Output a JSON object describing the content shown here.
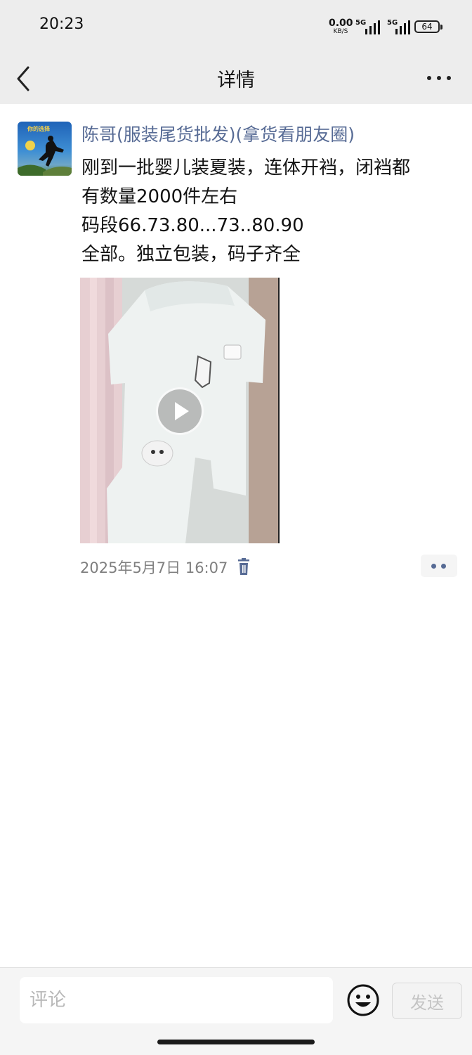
{
  "status_bar": {
    "time": "20:23",
    "net_speed_value": "0.00",
    "net_speed_unit": "KB/S",
    "signal_1_label": "5G",
    "signal_2_label": "5G",
    "battery": "64"
  },
  "header": {
    "title": "详情",
    "back_icon": "chevron-left-icon",
    "more_icon": "more-dots-icon"
  },
  "post": {
    "author": "陈哥(服装尾货批发)(拿货看朋友圈)",
    "avatar_text": "你的选择",
    "text_lines": [
      "刚到一批婴儿装夏装，连体开裆，闭裆都",
      "有数量2000件左右",
      "码段66.73.80...73..80.90",
      "全部。独立包装，码子齐全"
    ],
    "media": {
      "type": "video",
      "play_icon": "play-icon"
    },
    "timestamp": "2025年5月7日 16:07",
    "delete_icon": "trash-icon",
    "action_icon": "more-dots-icon"
  },
  "comment_bar": {
    "placeholder": "评论",
    "emoji_icon": "smiley-icon",
    "send_label": "发送"
  },
  "colors": {
    "bar_background": "#ededed",
    "link_blue": "#576b95",
    "timestamp_gray": "#7f7f7f"
  }
}
